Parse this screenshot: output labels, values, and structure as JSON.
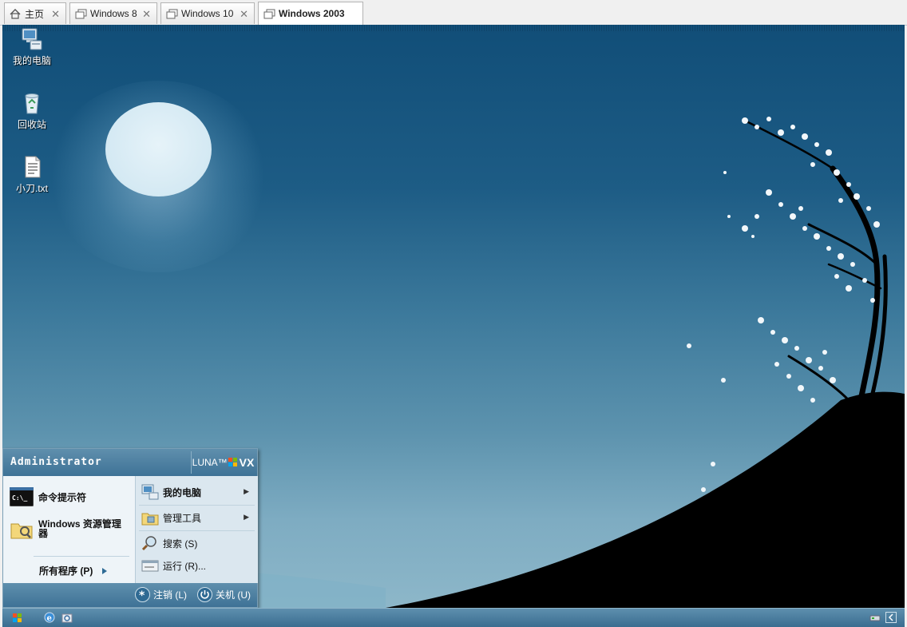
{
  "tabs": [
    {
      "label": "主页",
      "icon": "home-icon",
      "active": false
    },
    {
      "label": "Windows 8",
      "icon": "vm-icon",
      "active": false
    },
    {
      "label": "Windows 10",
      "icon": "vm-icon",
      "active": false
    },
    {
      "label": "Windows 2003",
      "icon": "vm-icon",
      "active": true
    }
  ],
  "desktop": {
    "icons": [
      {
        "label": "我的电脑",
        "icon": "my-computer-icon"
      },
      {
        "label": "回收站",
        "icon": "recycle-bin-icon"
      },
      {
        "label": "小刀.txt",
        "icon": "text-file-icon"
      }
    ]
  },
  "start_menu": {
    "user": "Administrator",
    "logo_text": "LUNA™",
    "logo_badge": "VX",
    "pinned": [
      {
        "label": "命令提示符",
        "icon": "command-prompt-icon"
      },
      {
        "label": "Windows 资源管理器",
        "icon": "explorer-icon"
      }
    ],
    "all_programs": "所有程序 (P)",
    "right_items": [
      {
        "label": "我的电脑",
        "icon": "my-computer-icon"
      },
      {
        "label": "管理工具",
        "icon": "admin-tools-icon"
      },
      {
        "label": "搜索 (S)",
        "icon": "search-icon"
      },
      {
        "label": "运行 (R)...",
        "icon": "run-icon"
      }
    ],
    "logoff": "注销 (L)",
    "shutdown": "关机 (U)"
  },
  "colors": {
    "sky_top": "#114e78",
    "sky_bottom": "#8db7c9",
    "hill": "#000000"
  }
}
